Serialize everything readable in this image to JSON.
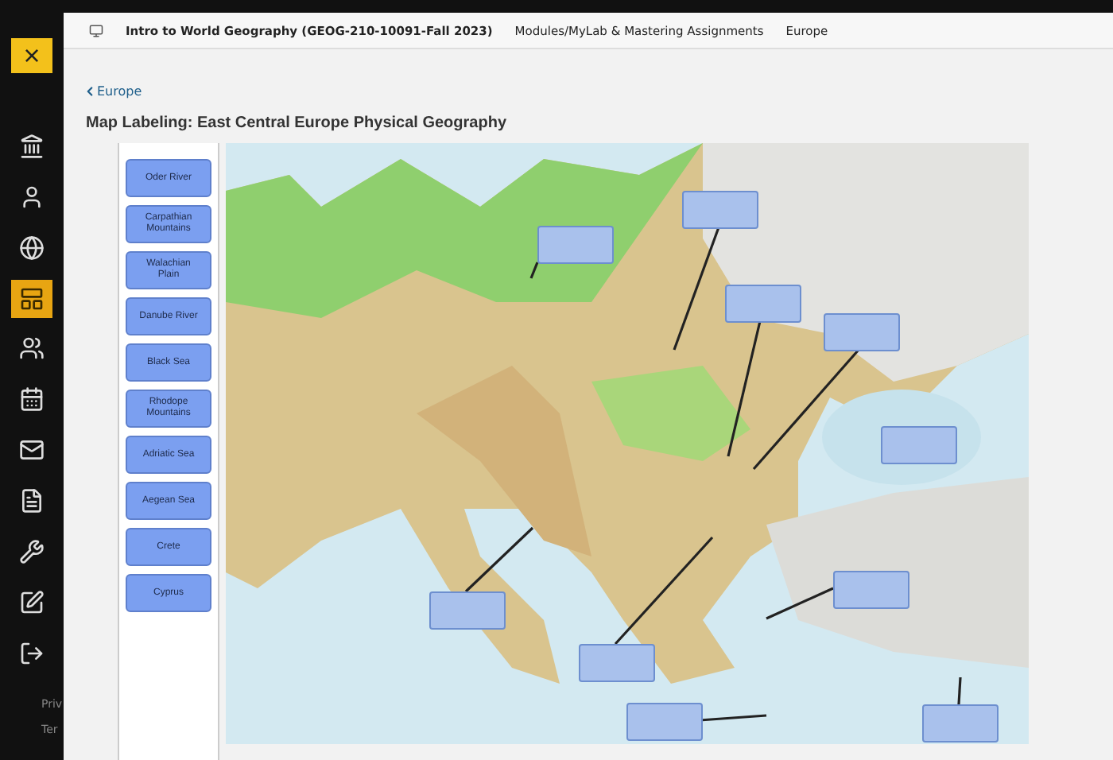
{
  "nav": {
    "close": "×",
    "items": [
      {
        "selected": false
      },
      {
        "selected": false
      },
      {
        "selected": false
      },
      {
        "selected": true
      },
      {
        "selected": false
      },
      {
        "selected": false
      },
      {
        "selected": false
      },
      {
        "selected": false
      },
      {
        "selected": false
      },
      {
        "selected": false
      },
      {
        "selected": false
      }
    ],
    "footer": [
      "Priv",
      "Ter"
    ]
  },
  "breadcrumb": [
    "Intro to World Geography (GEOG-210-10091-Fall 2023)",
    "Modules/MyLab & Mastering Assignments",
    "Europe"
  ],
  "back_link": "Europe",
  "title": "Map Labeling: East Central Europe Physical Geography",
  "labels": [
    "Oder River",
    "Carpathian Mountains",
    "Walachian Plain",
    "Danube River",
    "Black Sea",
    "Rhodope Mountains",
    "Adriatic Sea",
    "Aegean Sea",
    "Crete",
    "Cyprus"
  ]
}
